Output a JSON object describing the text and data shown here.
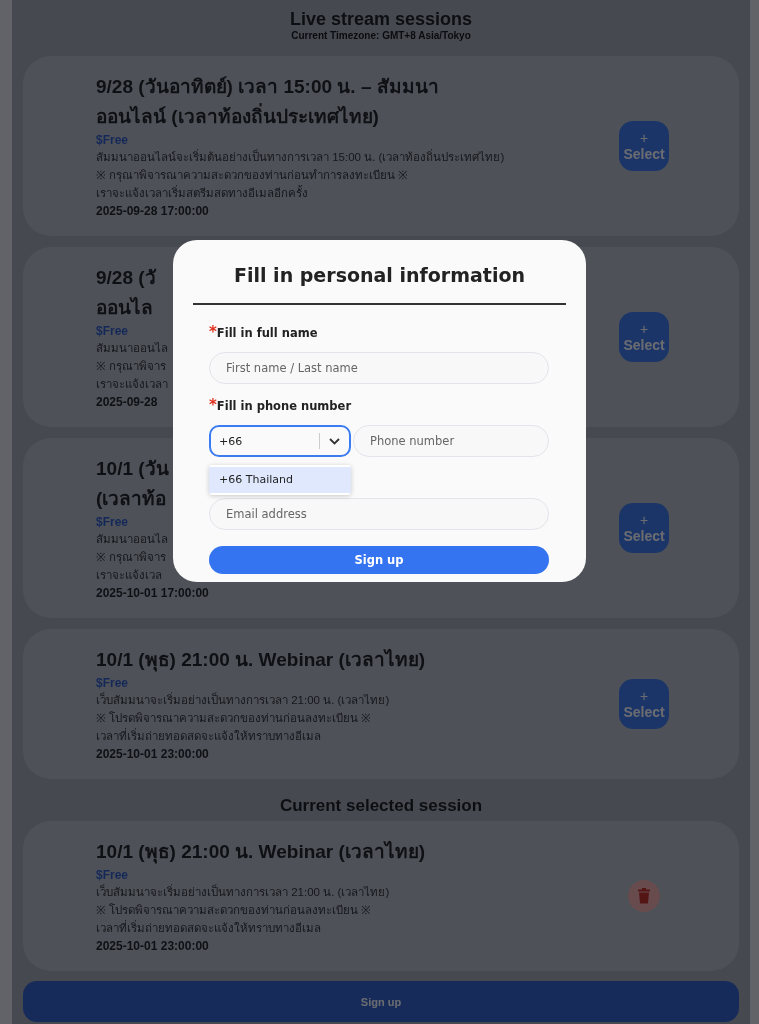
{
  "header": {
    "title": "Live stream sessions",
    "timezone": "Current Timezone: GMT+8 Asia/Tokyo"
  },
  "sessions": [
    {
      "title_lines": [
        "9/28 (วันอาทิตย์) เวลา 15:00 น. – สัมมนา",
        "ออนไลน์ (เวลาท้องถิ่นประเทศไทย)"
      ],
      "price": "$Free",
      "description": [
        "สัมมนาออนไลน์จะเริ่มต้นอย่างเป็นทางการเวลา 15:00 น. (เวลาท้องถิ่นประเทศไทย)",
        "※ กรุณาพิจารณาความสะดวกของท่านก่อนทำการลงทะเบียน ※",
        "เราจะแจ้งเวลาเริ่มสตรีมสดทางอีเมลอีกครั้ง"
      ],
      "datetime": "2025-09-28 17:00:00",
      "action_icon": "+",
      "action": "Select"
    },
    {
      "title_lines": [
        "9/28 (วั",
        "ออนไล"
      ],
      "price": "$Free",
      "description": [
        "สัมมนาออนไล",
        "※ กรุณาพิจาร",
        "เราจะแจ้งเวลา"
      ],
      "datetime": "2025-09-28",
      "action_icon": "+",
      "action": "Select"
    },
    {
      "title_lines": [
        "10/1 (วัน",
        "(เวลาท้อ"
      ],
      "price": "$Free",
      "description": [
        "สัมมนาออนไล",
        "※ กรุณาพิจาร",
        "เราจะแจ้งเวล"
      ],
      "datetime": "2025-10-01 17:00:00",
      "action_icon": "+",
      "action": "Select"
    },
    {
      "title_lines": [
        "10/1 (พุธ) 21:00 น. Webinar (เวลาไทย)"
      ],
      "price": "$Free",
      "description": [
        "เว็บสัมมนาจะเริ่มอย่างเป็นทางการเวลา 21:00 น. (เวลาไทย)",
        "※ โปรดพิจารณาความสะดวกของท่านก่อนลงทะเบียน ※",
        "เวลาที่เริ่มถ่ายทอดสดจะแจ้งให้ทราบทางอีเมล"
      ],
      "datetime": "2025-10-01 23:00:00",
      "action_icon": "+",
      "action": "Select"
    }
  ],
  "selected_heading": "Current selected session",
  "selected_session": {
    "title_lines": [
      "10/1 (พุธ) 21:00 น. Webinar (เวลาไทย)"
    ],
    "price": "$Free",
    "description": [
      "เว็บสัมมนาจะเริ่มอย่างเป็นทางการเวลา 21:00 น. (เวลาไทย)",
      "※ โปรดพิจารณาความสะดวกของท่านก่อนลงทะเบียน ※",
      "เวลาที่เริ่มถ่ายทอดสดจะแจ้งให้ทราบทางอีเมล"
    ],
    "datetime": "2025-10-01 23:00:00"
  },
  "footer_button": "Sign up",
  "modal": {
    "title": "Fill in personal information",
    "fields": [
      {
        "kind": "text",
        "marker": "*",
        "label": "Fill in full name",
        "placeholder": "First name / Last name"
      },
      {
        "kind": "phone",
        "marker": "*",
        "label": "Fill in phone number",
        "code": "+66",
        "focused": true,
        "placeholder": "Phone number",
        "options": [
          {
            "label": "+66 Thailand",
            "selected": true
          }
        ]
      },
      {
        "kind": "text",
        "placeholder": "Email address"
      }
    ],
    "submit": "Sign up"
  }
}
